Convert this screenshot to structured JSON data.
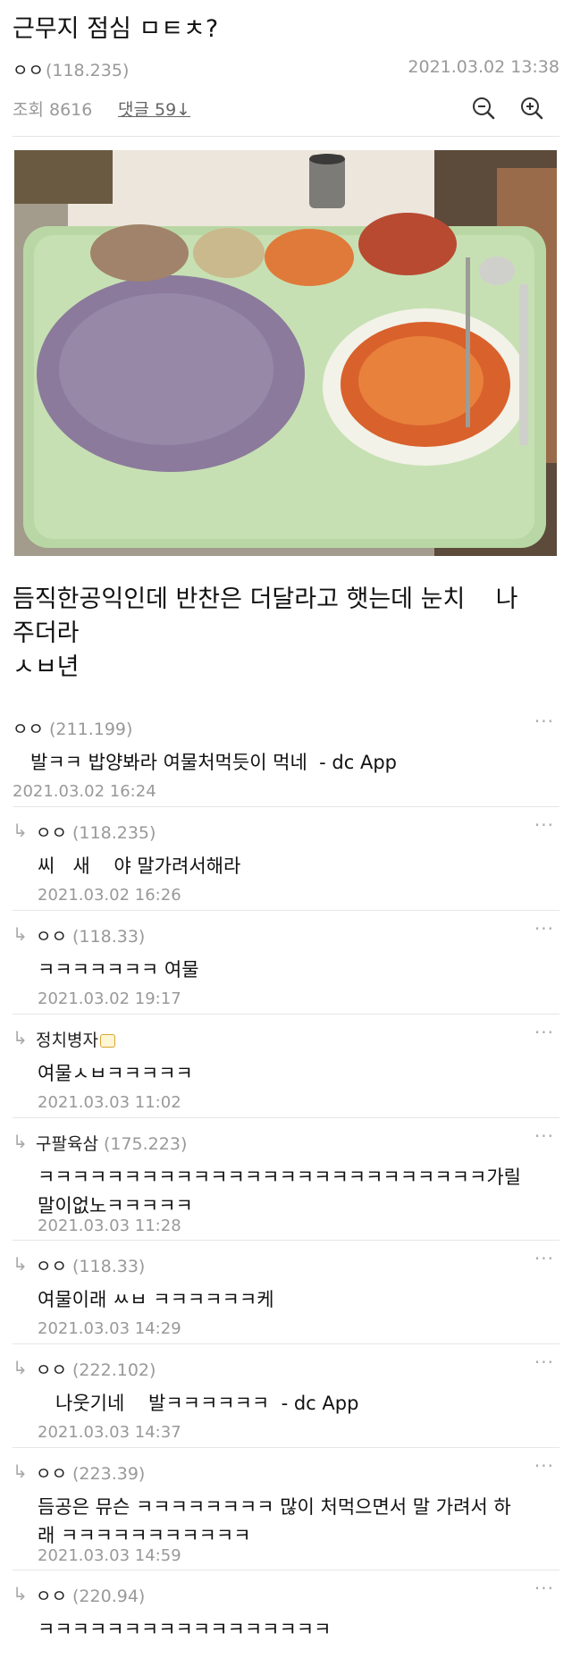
{
  "post": {
    "title": "근무지 점심 ㅁㅌㅊ?",
    "author": "ㅇㅇ",
    "author_ip": "(118.235)",
    "date": "2021.03.02 13:38",
    "views_label": "조회 8616",
    "comments_label": "댓글 59↓"
  },
  "photo": {
    "description_icon": "lunch-tray-photo"
  },
  "body_lines": [
    "듬직한공익인데 반찬은 더달라고 햇는데 눈치    나",
    "주더라",
    "ㅅㅂ년"
  ],
  "more_glyph": "···",
  "reply_glyph": "↳",
  "comments": [
    {
      "type": "root",
      "name": "ㅇㅇ",
      "ip": "(211.199)",
      "text": "발ㅋㅋ 밥양봐라 여물처먹듯이 먹네  - dc App",
      "date": "2021.03.02 16:24"
    },
    {
      "type": "rep",
      "name": "ㅇㅇ",
      "ip": "(118.235)",
      "text": "씨   새    야 말가려서해라",
      "date": "2021.03.02 16:26"
    },
    {
      "type": "rep",
      "name": "ㅇㅇ",
      "ip": "(118.33)",
      "text": "ㅋㅋㅋㅋㅋㅋㅋ 여물",
      "date": "2021.03.02 19:17"
    },
    {
      "type": "rep",
      "name": "정치병자",
      "ip": "",
      "text": "여물ㅅㅂㅋㅋㅋㅋㅋ",
      "date": "2021.03.03 11:02"
    },
    {
      "type": "rep",
      "name": "구팔육삼",
      "ip": "(175.223)",
      "text": "ㅋㅋㅋㅋㅋㅋㅋㅋㅋㅋㅋㅋㅋㅋㅋㅋㅋㅋㅋㅋㅋㅋㅋㅋㅋㅋ가릴\n말이없노ㅋㅋㅋㅋㅋ",
      "date": "2021.03.03 11:28"
    },
    {
      "type": "rep",
      "name": "ㅇㅇ",
      "ip": "(118.33)",
      "text": "여물이래 ㅆㅂ ㅋㅋㅋㅋㅋㅋ케",
      "date": "2021.03.03 14:29"
    },
    {
      "type": "rep",
      "name": "ㅇㅇ",
      "ip": "(222.102)",
      "text": "   나웃기네    발ㅋㅋㅋㅋㅋㅋ  - dc App",
      "date": "2021.03.03 14:37"
    },
    {
      "type": "rep",
      "name": "ㅇㅇ",
      "ip": "(223.39)",
      "text": "듬공은 뮤슨 ㅋㅋㅋㅋㅋㅋㅋㅋ 많이 처먹으면서 말 가려서 하\n래 ㅋㅋㅋㅋㅋㅋㅋㅋㅋㅋㅋ",
      "date": "2021.03.03 14:59"
    },
    {
      "type": "rep",
      "name": "ㅇㅇ",
      "ip": "(220.94)",
      "text": "ㅋㅋㅋㅋㅋㅋㅋㅋㅋㅋㅋㅋㅋㅋㅋㅋㅋ",
      "date": ""
    }
  ]
}
